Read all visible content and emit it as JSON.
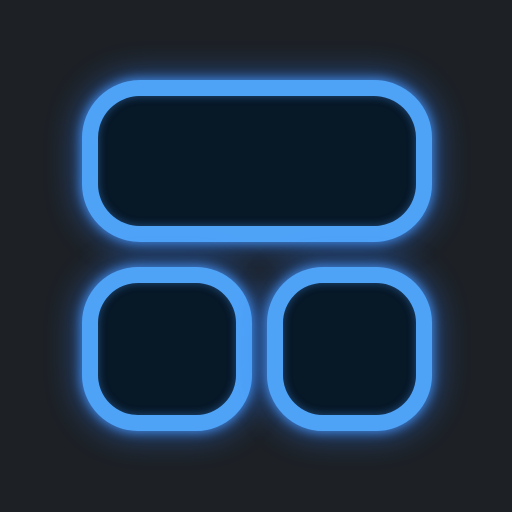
{
  "app_icon": {
    "icon_name": "widget-layout-icon",
    "colors": {
      "background": "#1d2126",
      "tile_fill": "#071827",
      "tile_outline": "#4fa3f7",
      "glow": "#3080ff"
    },
    "tiles": [
      "wide-top-tile",
      "square-bottom-left-tile",
      "square-bottom-right-tile"
    ]
  }
}
